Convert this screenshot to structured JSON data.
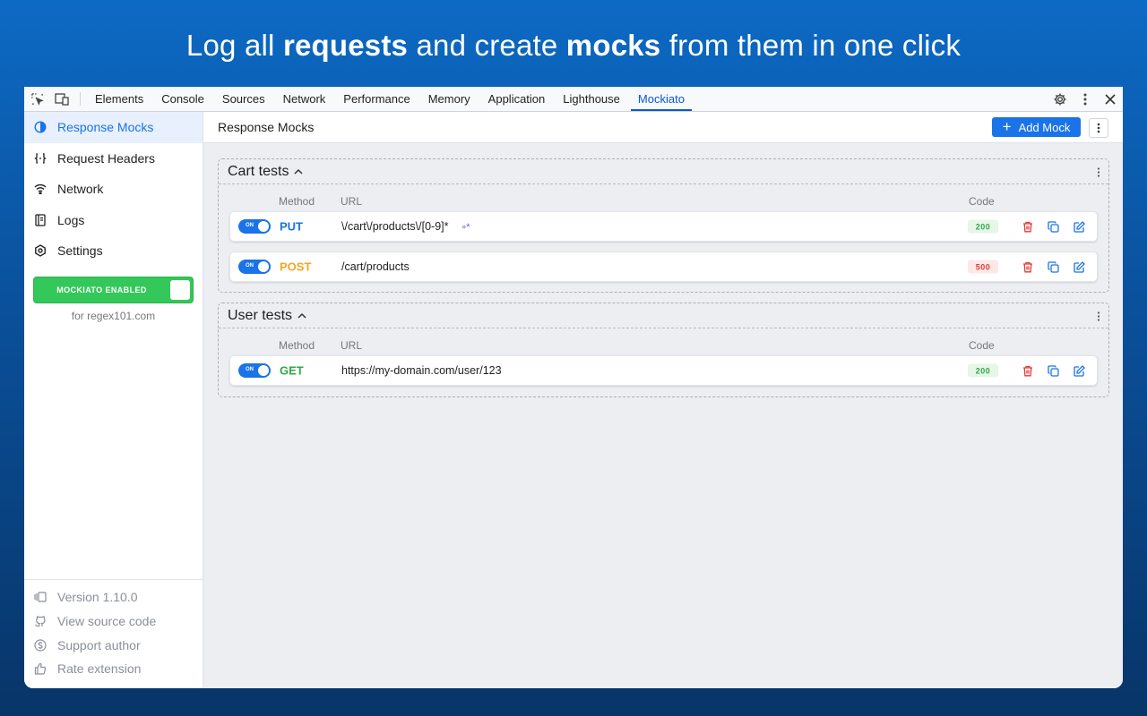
{
  "headline": {
    "part1": "Log all ",
    "bold1": "requests",
    "part2": " and create ",
    "bold2": "mocks",
    "part3": " from them in one click"
  },
  "devtools": {
    "tabs": [
      {
        "label": "Elements",
        "active": false
      },
      {
        "label": "Console",
        "active": false
      },
      {
        "label": "Sources",
        "active": false
      },
      {
        "label": "Network",
        "active": false
      },
      {
        "label": "Performance",
        "active": false
      },
      {
        "label": "Memory",
        "active": false
      },
      {
        "label": "Application",
        "active": false
      },
      {
        "label": "Lighthouse",
        "active": false
      },
      {
        "label": "Mockiato",
        "active": true
      }
    ]
  },
  "sidebar": {
    "items": [
      {
        "label": "Response Mocks",
        "icon": "contrast-icon",
        "active": true
      },
      {
        "label": "Request Headers",
        "icon": "braces-icon",
        "active": false
      },
      {
        "label": "Network",
        "icon": "wifi-icon",
        "active": false
      },
      {
        "label": "Logs",
        "icon": "log-icon",
        "active": false
      },
      {
        "label": "Settings",
        "icon": "settings-icon",
        "active": false
      }
    ],
    "enabled_label": "MOCKIATO ENABLED",
    "domain_text": "for regex101.com",
    "footer": [
      {
        "label": "Version 1.10.0",
        "icon": "version-icon"
      },
      {
        "label": "View source code",
        "icon": "github-icon"
      },
      {
        "label": "Support author",
        "icon": "dollar-icon"
      },
      {
        "label": "Rate extension",
        "icon": "thumbs-up-icon"
      }
    ]
  },
  "content": {
    "title": "Response Mocks",
    "add_label": "Add Mock",
    "columns": {
      "method": "Method",
      "url": "URL",
      "code": "Code"
    },
    "groups": [
      {
        "title": "Cart tests",
        "mocks": [
          {
            "toggle": "ON",
            "method": "PUT",
            "url": "\\/cart\\/products\\/[0-9]*",
            "regex": true,
            "code": "200"
          },
          {
            "toggle": "ON",
            "method": "POST",
            "url": "/cart/products",
            "regex": false,
            "code": "500"
          }
        ]
      },
      {
        "title": "User tests",
        "mocks": [
          {
            "toggle": "ON",
            "method": "GET",
            "url": "https://my-domain.com/user/123",
            "regex": false,
            "code": "200"
          }
        ]
      }
    ]
  },
  "colors": {
    "accent": "#1a73e8",
    "put": "#1a73e8",
    "post": "#f5a623",
    "get": "#2eaa44",
    "code_ok_bg": "#e6f6e9",
    "code_ok_fg": "#2eaa44",
    "code_err_bg": "#fde8e8",
    "code_err_fg": "#e03b3b",
    "enabled_green": "#34c759"
  }
}
